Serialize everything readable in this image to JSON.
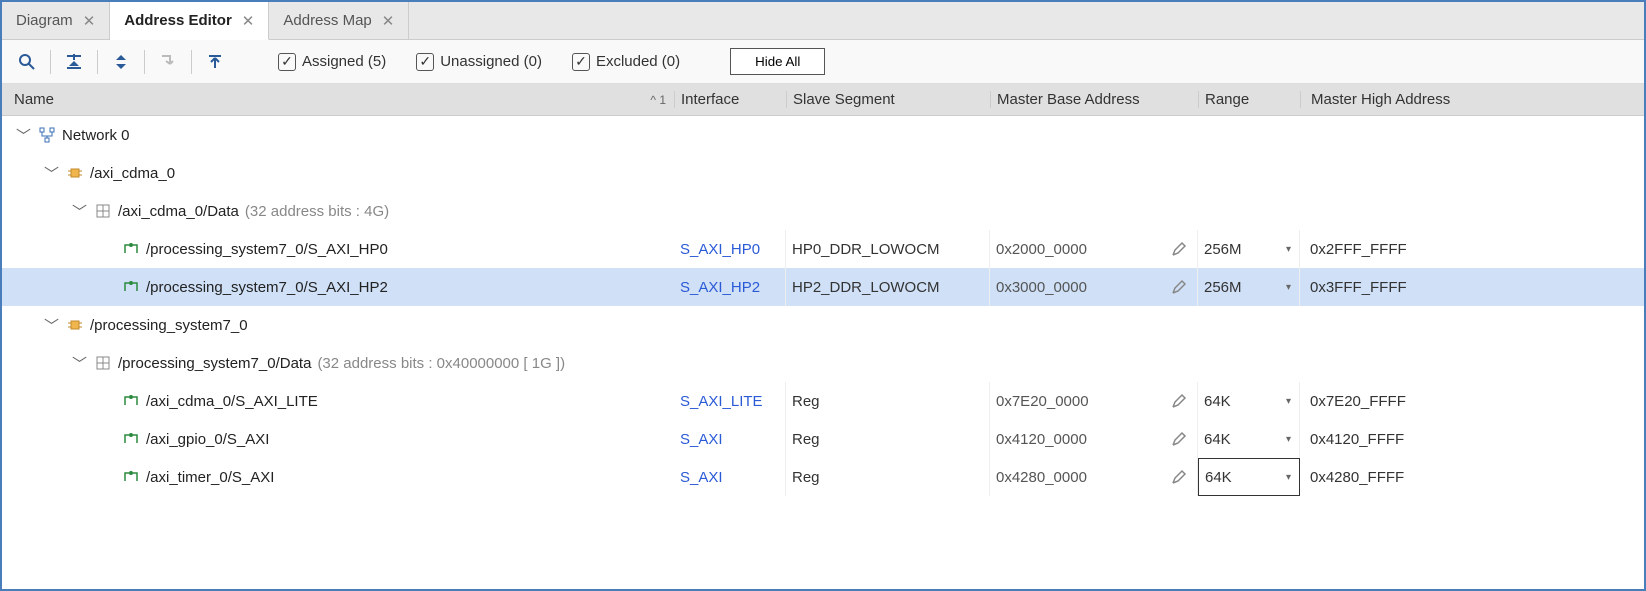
{
  "tabs": [
    {
      "label": "Diagram",
      "active": false
    },
    {
      "label": "Address Editor",
      "active": true
    },
    {
      "label": "Address Map",
      "active": false
    }
  ],
  "toolbar": {
    "assigned": {
      "label": "Assigned (5)",
      "checked": true
    },
    "unassigned": {
      "label": "Unassigned (0)",
      "checked": true
    },
    "excluded": {
      "label": "Excluded (0)",
      "checked": true
    },
    "hide_all": "Hide All"
  },
  "columns": {
    "name": "Name",
    "sort": "1",
    "interface": "Interface",
    "slave": "Slave Segment",
    "base": "Master Base Address",
    "range": "Range",
    "high": "Master High Address"
  },
  "tree": {
    "network": {
      "label": "Network 0"
    },
    "axi_cdma": {
      "label": "/axi_cdma_0",
      "data": {
        "label": "/axi_cdma_0/Data",
        "note": "(32 address bits : 4G)"
      },
      "rows": [
        {
          "name": "/processing_system7_0/S_AXI_HP0",
          "iface": "S_AXI_HP0",
          "slave": "HP0_DDR_LOWOCM",
          "base": "0x2000_0000",
          "range": "256M",
          "high": "0x2FFF_FFFF",
          "selected": false
        },
        {
          "name": "/processing_system7_0/S_AXI_HP2",
          "iface": "S_AXI_HP2",
          "slave": "HP2_DDR_LOWOCM",
          "base": "0x3000_0000",
          "range": "256M",
          "high": "0x3FFF_FFFF",
          "selected": true
        }
      ]
    },
    "ps7": {
      "label": "/processing_system7_0",
      "data": {
        "label": "/processing_system7_0/Data",
        "note": "(32 address bits : 0x40000000 [ 1G ])"
      },
      "rows": [
        {
          "name": "/axi_cdma_0/S_AXI_LITE",
          "iface": "S_AXI_LITE",
          "slave": "Reg",
          "base": "0x7E20_0000",
          "range": "64K",
          "high": "0x7E20_FFFF",
          "range_boxed": false
        },
        {
          "name": "/axi_gpio_0/S_AXI",
          "iface": "S_AXI",
          "slave": "Reg",
          "base": "0x4120_0000",
          "range": "64K",
          "high": "0x4120_FFFF",
          "range_boxed": false
        },
        {
          "name": "/axi_timer_0/S_AXI",
          "iface": "S_AXI",
          "slave": "Reg",
          "base": "0x4280_0000",
          "range": "64K",
          "high": "0x4280_FFFF",
          "range_boxed": true
        }
      ]
    }
  }
}
